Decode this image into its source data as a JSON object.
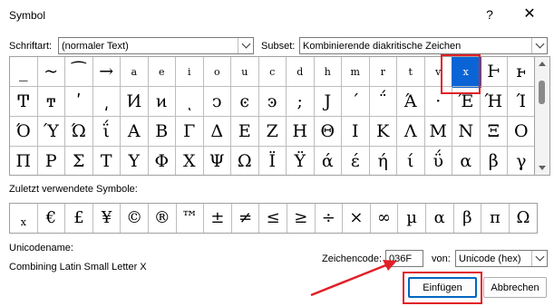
{
  "window": {
    "title": "Symbol",
    "help_label": "?",
    "close_label": "✕"
  },
  "font_label": "Schriftart:",
  "font_value": "(normaler Text)",
  "subset_label": "Subset:",
  "subset_value": "Kombinierende diakritische Zeichen",
  "grid_rows": [
    [
      "_",
      "~",
      "⁀",
      "→",
      "a",
      "e",
      "i",
      "o",
      "u",
      "c",
      "d",
      "h",
      "m",
      "r",
      "t",
      "v",
      "x",
      "Ⱶ",
      "ⱶ"
    ],
    [
      "Ͳ",
      "ͳ",
      "ʹ",
      "͵",
      "Ͷ",
      "ͷ",
      "ͺ",
      "ͻ",
      "ͼ",
      "ͽ",
      ";",
      "Ϳ",
      "΄",
      "΅",
      "Ά",
      "·",
      "Έ",
      "Ή",
      "Ί"
    ],
    [
      "Ό",
      "Ύ",
      "Ώ",
      "ΐ",
      "Α",
      "Β",
      "Γ",
      "Δ",
      "Ε",
      "Ζ",
      "Η",
      "Θ",
      "Ι",
      "Κ",
      "Λ",
      "Μ",
      "Ν",
      "Ξ",
      "Ο"
    ],
    [
      "Π",
      "Ρ",
      "Σ",
      "Τ",
      "Υ",
      "Φ",
      "Χ",
      "Ψ",
      "Ω",
      "Ϊ",
      "Ϋ",
      "ά",
      "έ",
      "ή",
      "ί",
      "ΰ",
      "α",
      "β",
      "γ"
    ]
  ],
  "selected_symbol": "x",
  "recent_label": "Zuletzt verwendete Symbole:",
  "recent_symbols": [
    "x",
    "€",
    "£",
    "¥",
    "©",
    "®",
    "™",
    "±",
    "≠",
    "≤",
    "≥",
    "÷",
    "×",
    "∞",
    "µ",
    "α",
    "β",
    "π",
    "Ω"
  ],
  "unicode_name_label": "Unicodename:",
  "unicode_name": "Combining Latin Small Letter X",
  "char_code_label": "Zeichencode:",
  "char_code_value": "036F",
  "from_label": "von:",
  "from_value": "Unicode (hex)",
  "insert_label": "Einfügen",
  "cancel_label": "Abbrechen",
  "colors": {
    "selection": "#0a64d6",
    "annotation": "#e21f26"
  }
}
